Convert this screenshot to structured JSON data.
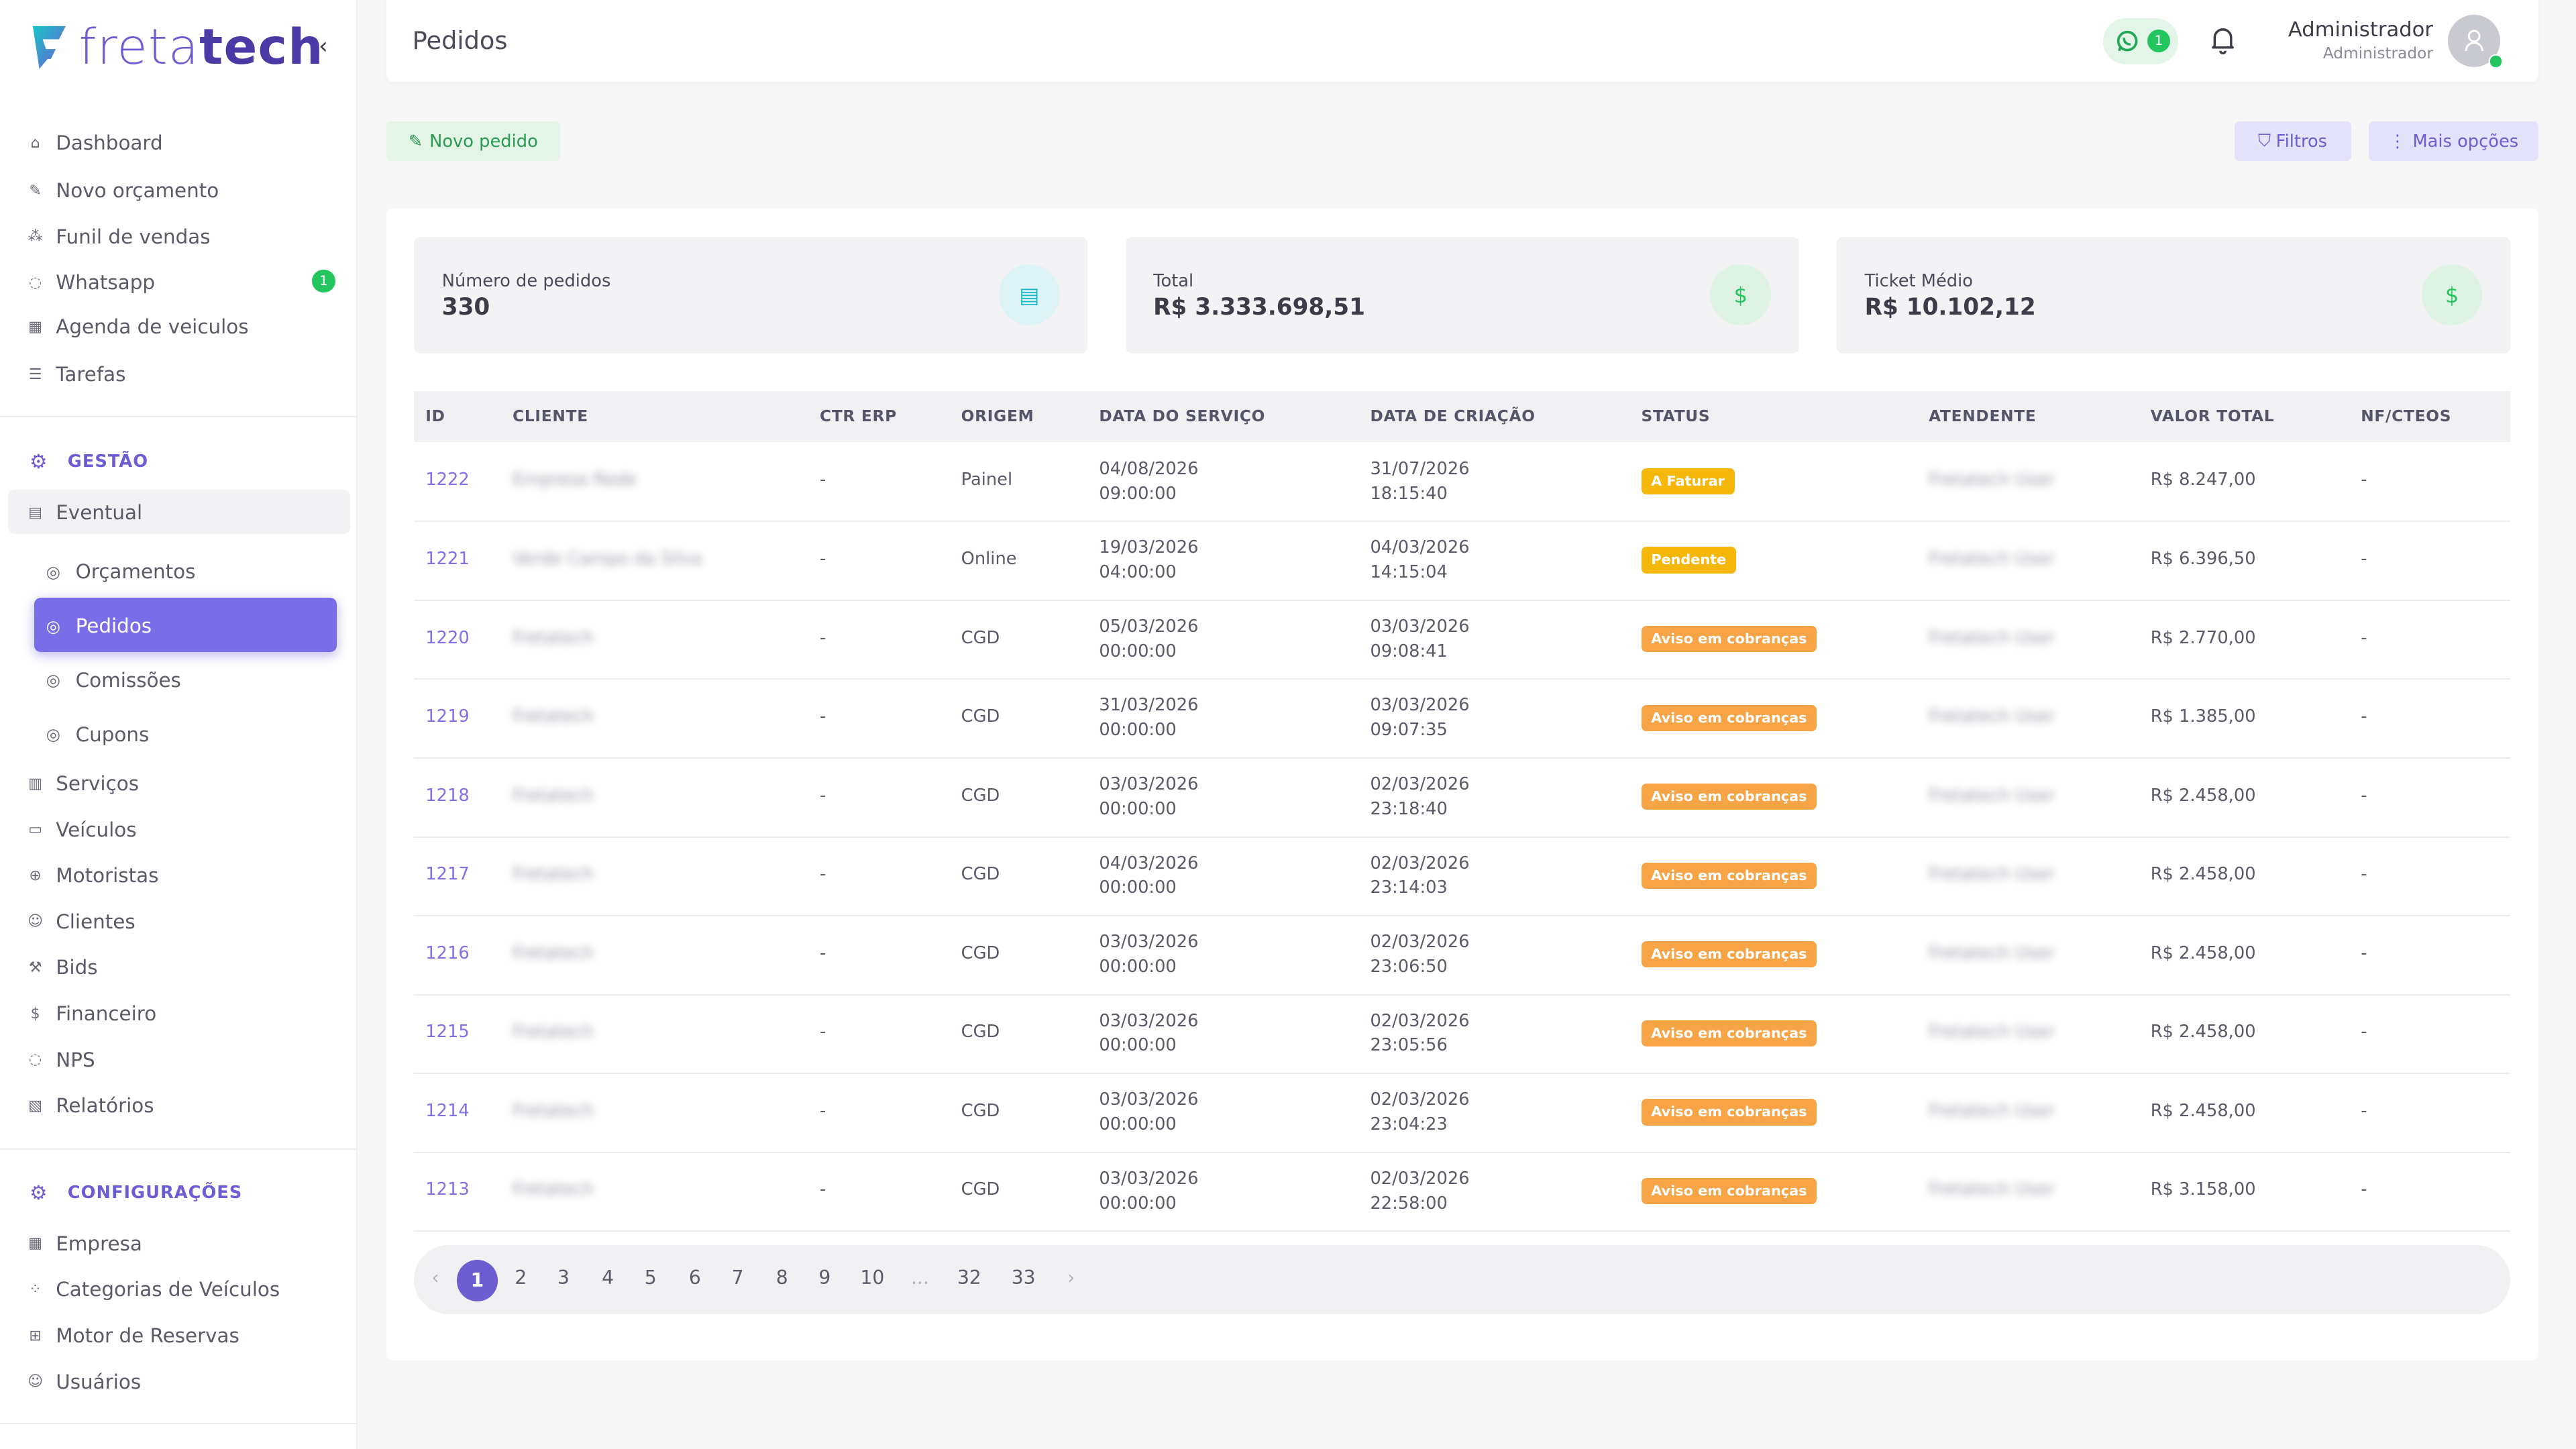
{
  "brand": {
    "name_light": "freta",
    "name_bold": "tech"
  },
  "sidebar": {
    "main_items": [
      {
        "label": "Dashboard",
        "icon": "home-icon"
      },
      {
        "label": "Novo orçamento",
        "icon": "edit-icon"
      },
      {
        "label": "Funil de vendas",
        "icon": "funnel-icon"
      },
      {
        "label": "Whatsapp",
        "icon": "whatsapp-icon",
        "badge": "1"
      },
      {
        "label": "Agenda de veiculos",
        "icon": "calendar-icon"
      },
      {
        "label": "Tarefas",
        "icon": "list-icon"
      }
    ],
    "gestao_title": "GESTÃO",
    "eventual": "Eventual",
    "eventual_sub": [
      "Orçamentos",
      "Pedidos",
      "Comissões",
      "Cupons"
    ],
    "gestao_items": [
      {
        "label": "Serviços"
      },
      {
        "label": "Veículos"
      },
      {
        "label": "Motoristas"
      },
      {
        "label": "Clientes"
      },
      {
        "label": "Bids"
      },
      {
        "label": "Financeiro"
      },
      {
        "label": "NPS"
      },
      {
        "label": "Relatórios"
      }
    ],
    "config_title": "CONFIGURAÇÕES",
    "config_items": [
      {
        "label": "Empresa"
      },
      {
        "label": "Categorias de Veículos"
      },
      {
        "label": "Motor de Reservas"
      },
      {
        "label": "Usuários"
      }
    ]
  },
  "header": {
    "title": "Pedidos",
    "whatsapp_count": "1",
    "user_name": "Administrador",
    "user_role": "Administrador"
  },
  "actions": {
    "novo_pedido": "Novo pedido",
    "filtros": "Filtros",
    "mais_opcoes": "Mais opções"
  },
  "stats": [
    {
      "label": "Número de pedidos",
      "value": "330",
      "icon": "document-icon",
      "color": "#16b8c8"
    },
    {
      "label": "Total",
      "value": "R$ 3.333.698,51",
      "icon": "dollar-icon",
      "color": "#22c55e"
    },
    {
      "label": "Ticket Médio",
      "value": "R$ 10.102,12",
      "icon": "dollar-icon",
      "color": "#22c55e"
    }
  ],
  "table": {
    "columns": [
      "ID",
      "CLIENTE",
      "CTR ERP",
      "ORIGEM",
      "DATA DO SERVIÇO",
      "DATA DE CRIAÇÃO",
      "STATUS",
      "ATENDENTE",
      "VALOR TOTAL",
      "NF/CTEOS"
    ],
    "rows": [
      {
        "id": "1222",
        "client": "Empresa Rede",
        "ctr": "-",
        "origin": "Painel",
        "svc_date": "04/08/2026",
        "svc_time": "09:00:00",
        "cr_date": "31/07/2026",
        "cr_time": "18:15:40",
        "status": "A Faturar",
        "status_color": "#f5b70a",
        "agent": "Fretatech User",
        "total": "R$ 8.247,00",
        "nf": "-"
      },
      {
        "id": "1221",
        "client": "Verde Campo da Silva",
        "ctr": "-",
        "origin": "Online",
        "svc_date": "19/03/2026",
        "svc_time": "04:00:00",
        "cr_date": "04/03/2026",
        "cr_time": "14:15:04",
        "status": "Pendente",
        "status_color": "#f5b70a",
        "agent": "Fretatech User",
        "total": "R$ 6.396,50",
        "nf": "-"
      },
      {
        "id": "1220",
        "client": "Fretatech",
        "ctr": "-",
        "origin": "CGD",
        "svc_date": "05/03/2026",
        "svc_time": "00:00:00",
        "cr_date": "03/03/2026",
        "cr_time": "09:08:41",
        "status": "Aviso em cobranças",
        "status_color": "#f6a445",
        "agent": "Fretatech User",
        "total": "R$ 2.770,00",
        "nf": "-"
      },
      {
        "id": "1219",
        "client": "Fretatech",
        "ctr": "-",
        "origin": "CGD",
        "svc_date": "31/03/2026",
        "svc_time": "00:00:00",
        "cr_date": "03/03/2026",
        "cr_time": "09:07:35",
        "status": "Aviso em cobranças",
        "status_color": "#f6a445",
        "agent": "Fretatech User",
        "total": "R$ 1.385,00",
        "nf": "-"
      },
      {
        "id": "1218",
        "client": "Fretatech",
        "ctr": "-",
        "origin": "CGD",
        "svc_date": "03/03/2026",
        "svc_time": "00:00:00",
        "cr_date": "02/03/2026",
        "cr_time": "23:18:40",
        "status": "Aviso em cobranças",
        "status_color": "#f6a445",
        "agent": "Fretatech User",
        "total": "R$ 2.458,00",
        "nf": "-"
      },
      {
        "id": "1217",
        "client": "Fretatech",
        "ctr": "-",
        "origin": "CGD",
        "svc_date": "04/03/2026",
        "svc_time": "00:00:00",
        "cr_date": "02/03/2026",
        "cr_time": "23:14:03",
        "status": "Aviso em cobranças",
        "status_color": "#f6a445",
        "agent": "Fretatech User",
        "total": "R$ 2.458,00",
        "nf": "-"
      },
      {
        "id": "1216",
        "client": "Fretatech",
        "ctr": "-",
        "origin": "CGD",
        "svc_date": "03/03/2026",
        "svc_time": "00:00:00",
        "cr_date": "02/03/2026",
        "cr_time": "23:06:50",
        "status": "Aviso em cobranças",
        "status_color": "#f6a445",
        "agent": "Fretatech User",
        "total": "R$ 2.458,00",
        "nf": "-"
      },
      {
        "id": "1215",
        "client": "Fretatech",
        "ctr": "-",
        "origin": "CGD",
        "svc_date": "03/03/2026",
        "svc_time": "00:00:00",
        "cr_date": "02/03/2026",
        "cr_time": "23:05:56",
        "status": "Aviso em cobranças",
        "status_color": "#f6a445",
        "agent": "Fretatech User",
        "total": "R$ 2.458,00",
        "nf": "-"
      },
      {
        "id": "1214",
        "client": "Fretatech",
        "ctr": "-",
        "origin": "CGD",
        "svc_date": "03/03/2026",
        "svc_time": "00:00:00",
        "cr_date": "02/03/2026",
        "cr_time": "23:04:23",
        "status": "Aviso em cobranças",
        "status_color": "#f6a445",
        "agent": "Fretatech User",
        "total": "R$ 2.458,00",
        "nf": "-"
      },
      {
        "id": "1213",
        "client": "Fretatech",
        "ctr": "-",
        "origin": "CGD",
        "svc_date": "03/03/2026",
        "svc_time": "00:00:00",
        "cr_date": "02/03/2026",
        "cr_time": "22:58:00",
        "status": "Aviso em cobranças",
        "status_color": "#f6a445",
        "agent": "Fretatech User",
        "total": "R$ 3.158,00",
        "nf": "-"
      }
    ]
  },
  "pagination": {
    "prev": "‹",
    "next": "›",
    "ellipsis": "...",
    "pages": [
      "1",
      "2",
      "3",
      "4",
      "5",
      "6",
      "7",
      "8",
      "9",
      "10",
      "32",
      "33"
    ],
    "active": "1"
  },
  "colors": {
    "accent": "#6c5dd3",
    "success": "#22c55e",
    "warning": "#f5b70a",
    "collection": "#f6a445"
  }
}
